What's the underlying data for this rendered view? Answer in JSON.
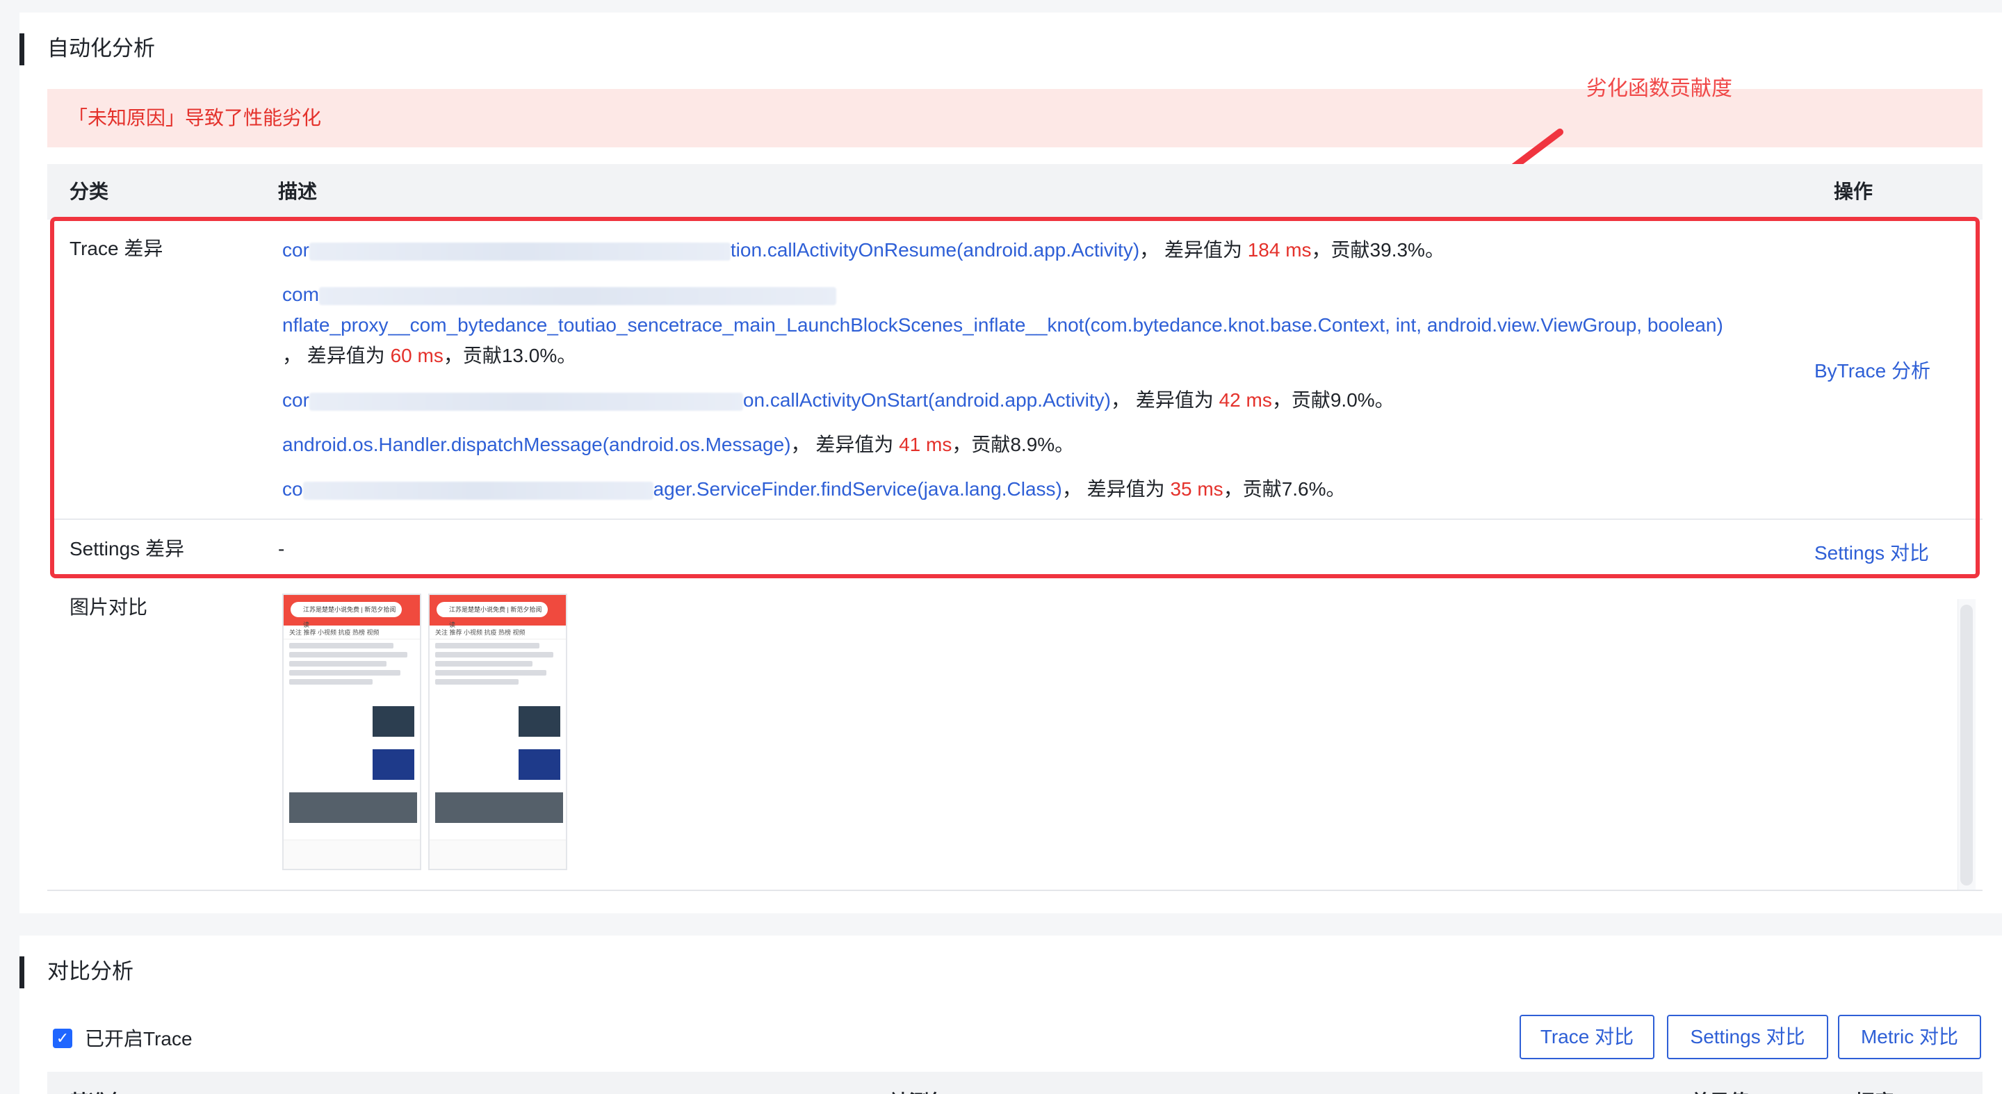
{
  "auto_analysis": {
    "title": "自动化分析",
    "alert": "「未知原因」导致了性能劣化",
    "annotation": "劣化函数贡献度",
    "columns": {
      "category": "分类",
      "description": "描述",
      "action": "操作"
    },
    "trace_row": {
      "category": "Trace 差异",
      "action": "ByTrace 分析",
      "items": [
        {
          "prefix": "cor",
          "fn": "tion.callActivityOnResume(android.app.Activity)",
          "sep": "，",
          "diff_label": "差异值为 ",
          "diff": "184 ms",
          "contrib": "，贡献39.3%。"
        },
        {
          "prefix": "com",
          "fn": "nflate_proxy__com_bytedance_toutiao_sencetrace_main_LaunchBlockScenes_inflate__knot(com.bytedance.knot.base.Context, int, android.view.ViewGroup, boolean)",
          "sep": "，",
          "diff_label": "差异值为 ",
          "diff": "60 ms",
          "contrib": "，贡献13.0%。"
        },
        {
          "prefix": "cor",
          "fn": "on.callActivityOnStart(android.app.Activity)",
          "sep": "，",
          "diff_label": "差异值为 ",
          "diff": "42 ms",
          "contrib": "，贡献9.0%。"
        },
        {
          "prefix": "",
          "fn": "android.os.Handler.dispatchMessage(android.os.Message)",
          "sep": "，",
          "diff_label": "差异值为 ",
          "diff": "41 ms",
          "contrib": "，贡献8.9%。"
        },
        {
          "prefix": "co",
          "fn": "ager.ServiceFinder.findService(java.lang.Class)",
          "sep": "，",
          "diff_label": "差异值为 ",
          "diff": "35 ms",
          "contrib": "，贡献7.6%。"
        }
      ]
    },
    "settings_row": {
      "category": "Settings 差异",
      "value": "-",
      "action": "Settings 对比"
    },
    "image_row": {
      "category": "图片对比",
      "phone_search": "江苏是楚楚小说免费 | 新范夕拾阅读",
      "phone_tabs": "关注  推荐  小视频  抗疫  热榜  视频"
    }
  },
  "compare_analysis": {
    "title": "对比分析",
    "trace_enabled_label": "已开启Trace",
    "buttons": {
      "trace": "Trace 对比",
      "settings": "Settings 对比",
      "metric": "Metric 对比"
    },
    "columns": {
      "base": "基准包(ms)",
      "test": "被测包(ms)",
      "diff": "差异值(ms)",
      "rate": "幅度(ms)"
    }
  },
  "colors": {
    "accent": "#2e5fd6",
    "danger": "#e4312b",
    "highlight_border": "#f0343f",
    "alert_bg": "#fde8e6"
  }
}
